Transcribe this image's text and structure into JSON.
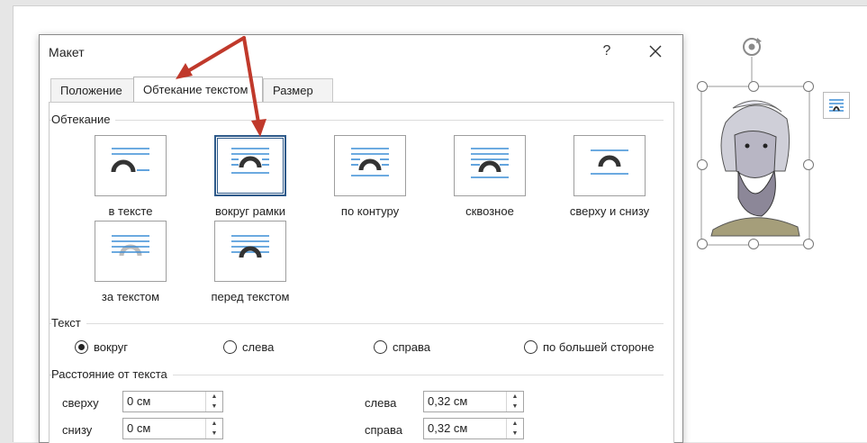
{
  "dialog": {
    "title": "Макет",
    "help_label": "?",
    "tabs": [
      {
        "label": "Положение",
        "active": false
      },
      {
        "label": "Обтекание текстом",
        "active": true
      },
      {
        "label": "Размер",
        "active": false
      }
    ]
  },
  "wrapping": {
    "group_label": "Обтекание",
    "options": [
      {
        "label": "в тексте",
        "icon": "wrap-inline-icon",
        "selected": false
      },
      {
        "label": "вокруг рамки",
        "icon": "wrap-square-icon",
        "selected": true
      },
      {
        "label": "по контуру",
        "icon": "wrap-tight-icon",
        "selected": false
      },
      {
        "label": "сквозное",
        "icon": "wrap-through-icon",
        "selected": false
      },
      {
        "label": "сверху и снизу",
        "icon": "wrap-top-bottom-icon",
        "selected": false
      },
      {
        "label": "за текстом",
        "icon": "wrap-behind-text-icon",
        "selected": false
      },
      {
        "label": "перед текстом",
        "icon": "wrap-in-front-icon",
        "selected": false
      }
    ]
  },
  "text_side": {
    "group_label": "Текст",
    "options": [
      {
        "label": "вокруг",
        "checked": true
      },
      {
        "label": "слева",
        "checked": false
      },
      {
        "label": "справа",
        "checked": false
      },
      {
        "label": "по большей стороне",
        "checked": false
      }
    ]
  },
  "distance": {
    "group_label": "Расстояние от текста",
    "top": {
      "label": "сверху",
      "value": "0 см"
    },
    "bottom": {
      "label": "снизу",
      "value": "0 см"
    },
    "left": {
      "label": "слева",
      "value": "0,32 см"
    },
    "right": {
      "label": "справа",
      "value": "0,32 см"
    }
  },
  "colors": {
    "accent": "#2e5a8a",
    "arrow": "#c0392b",
    "line_blue": "#3c8dd6"
  }
}
